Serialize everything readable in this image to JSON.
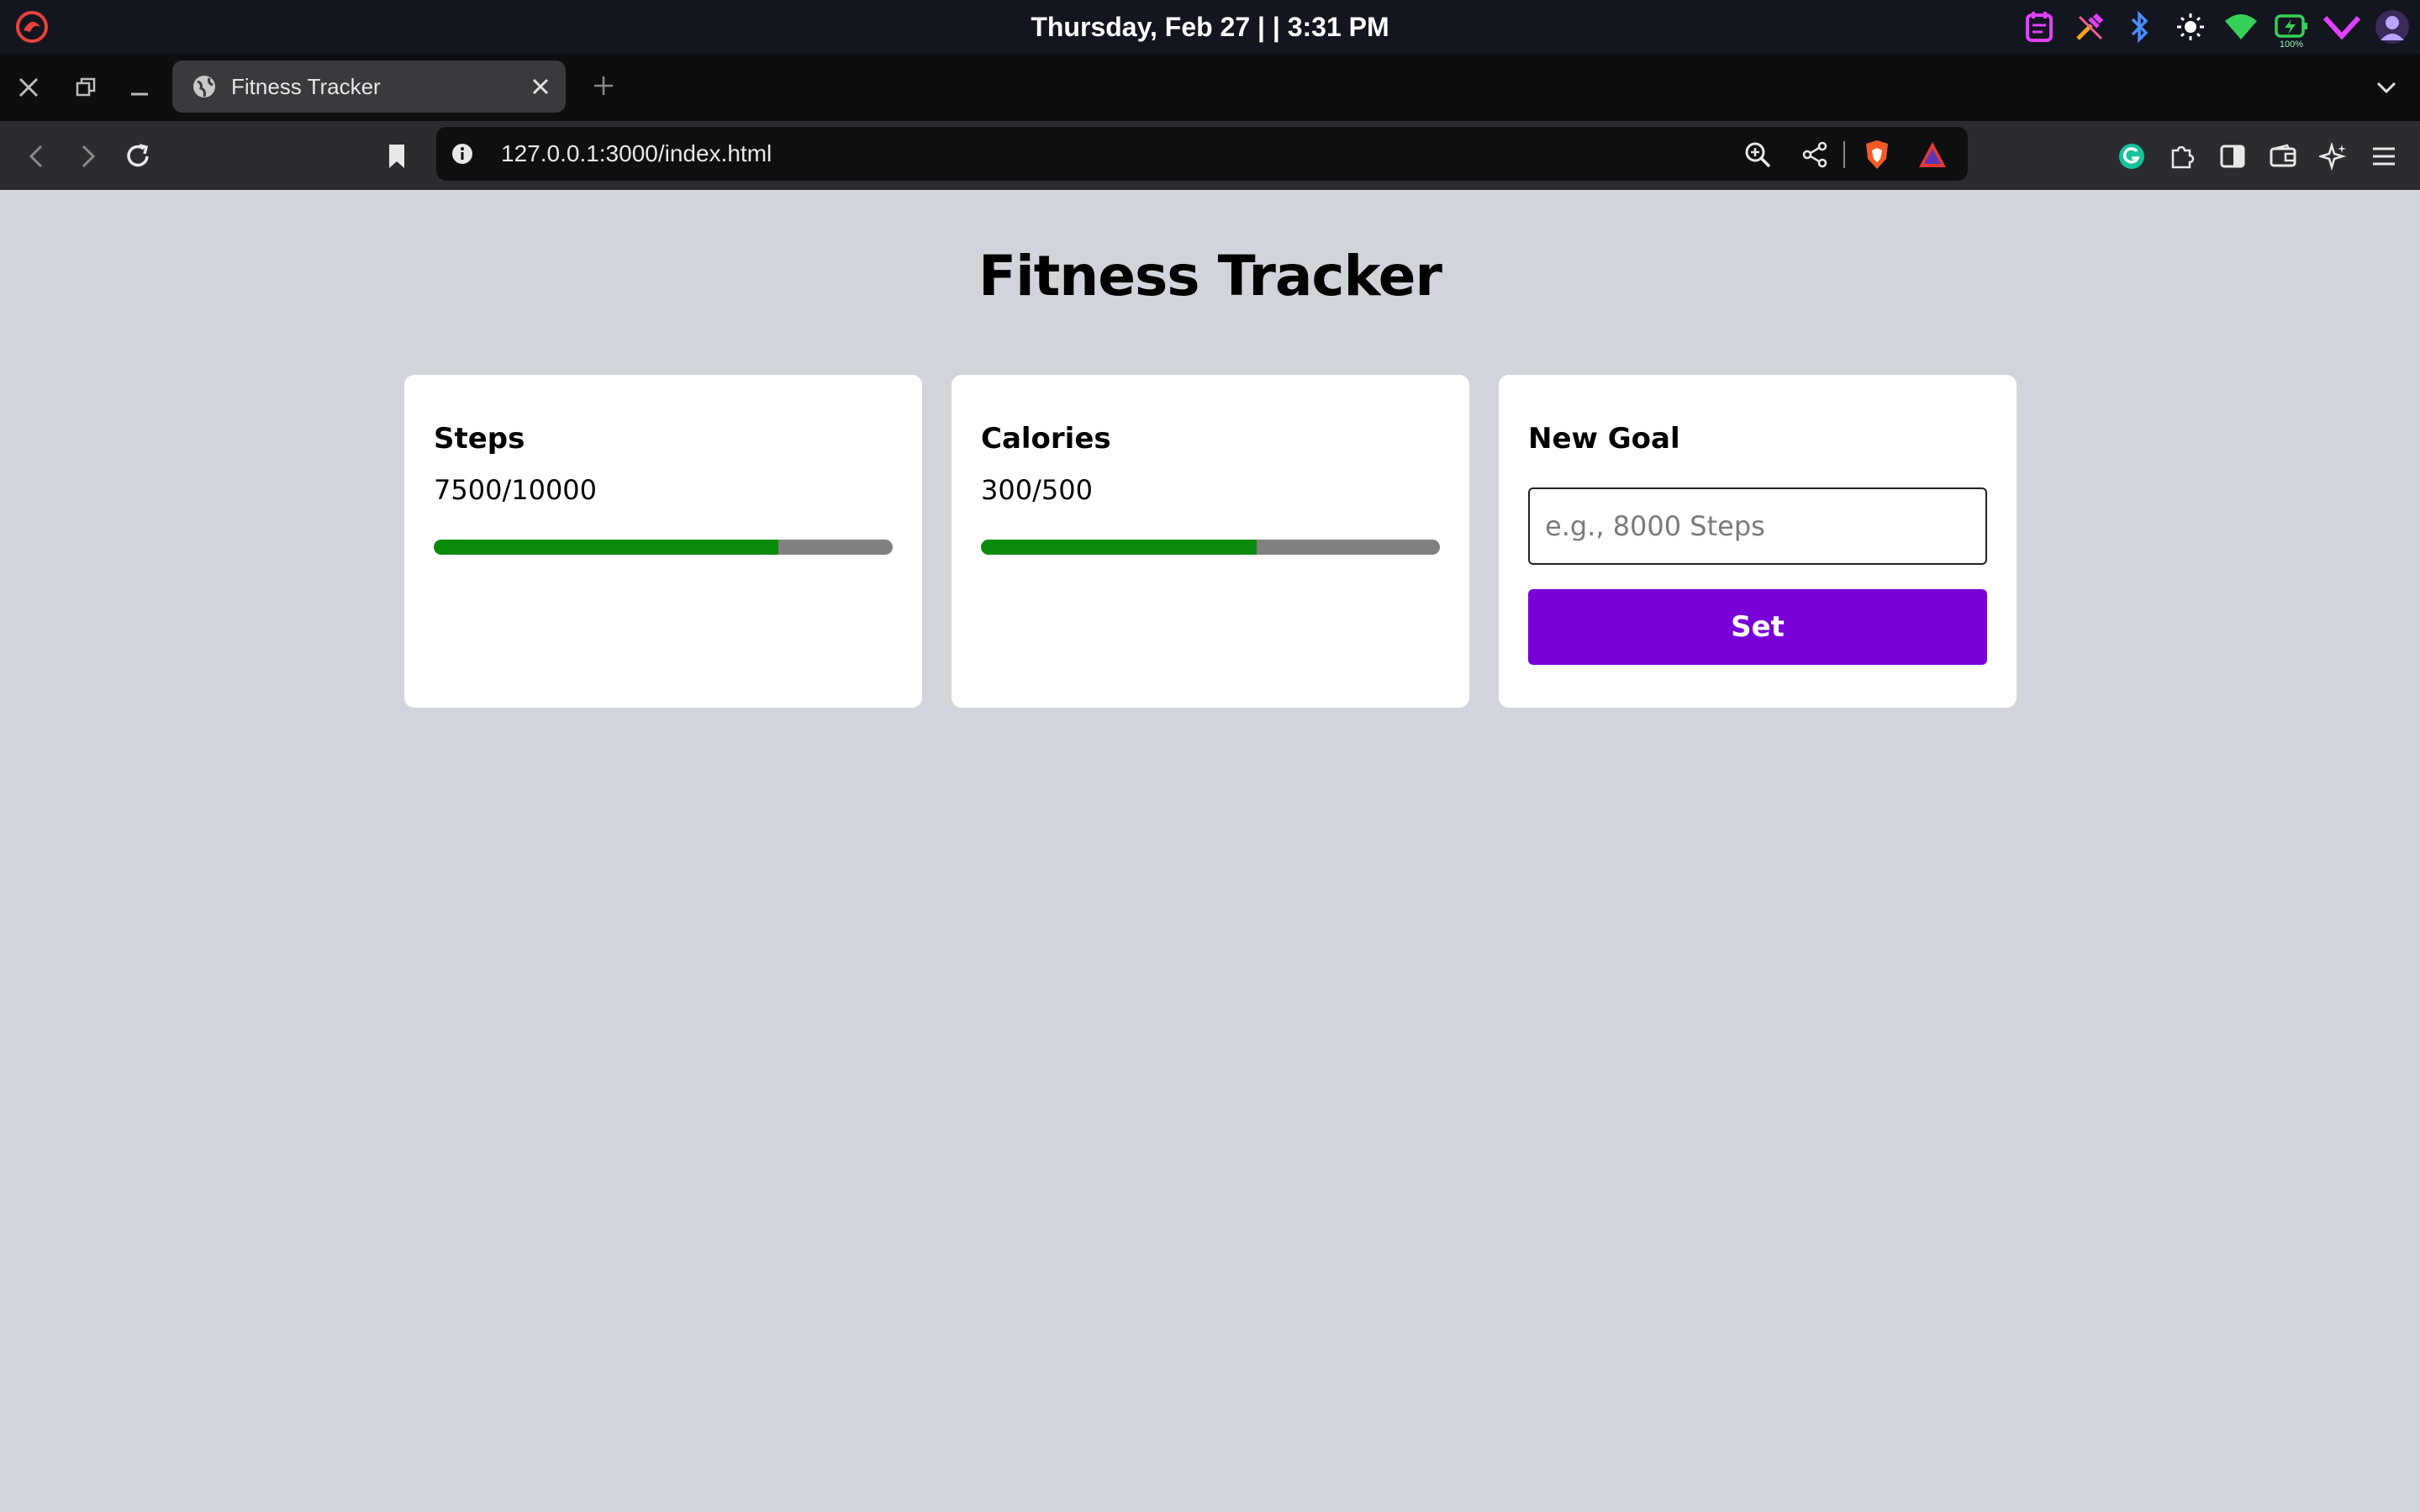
{
  "system_bar": {
    "clock": "Thursday, Feb 27 | | 3:31 PM",
    "battery_label": "100%",
    "tray_icons": [
      "notes-icon",
      "color-picker-icon",
      "bluetooth-icon",
      "brightness-icon",
      "wifi-icon",
      "battery-icon",
      "vpn-icon",
      "avatar-icon"
    ]
  },
  "browser": {
    "tab": {
      "title": "Fitness Tracker"
    },
    "url": "127.0.0.1:3000/index.html"
  },
  "page": {
    "title": "Fitness Tracker",
    "cards": [
      {
        "title": "Steps",
        "value": "7500/10000",
        "progress": 0.75
      },
      {
        "title": "Calories",
        "value": "300/500",
        "progress": 0.6
      }
    ],
    "goal": {
      "title": "New Goal",
      "placeholder": "e.g., 8000 Steps",
      "button_label": "Set"
    }
  },
  "colors": {
    "page_background": "#d1d5db",
    "progress_fill": "#0a8a0a",
    "progress_track": "#808080",
    "button": "#7a00d8"
  }
}
